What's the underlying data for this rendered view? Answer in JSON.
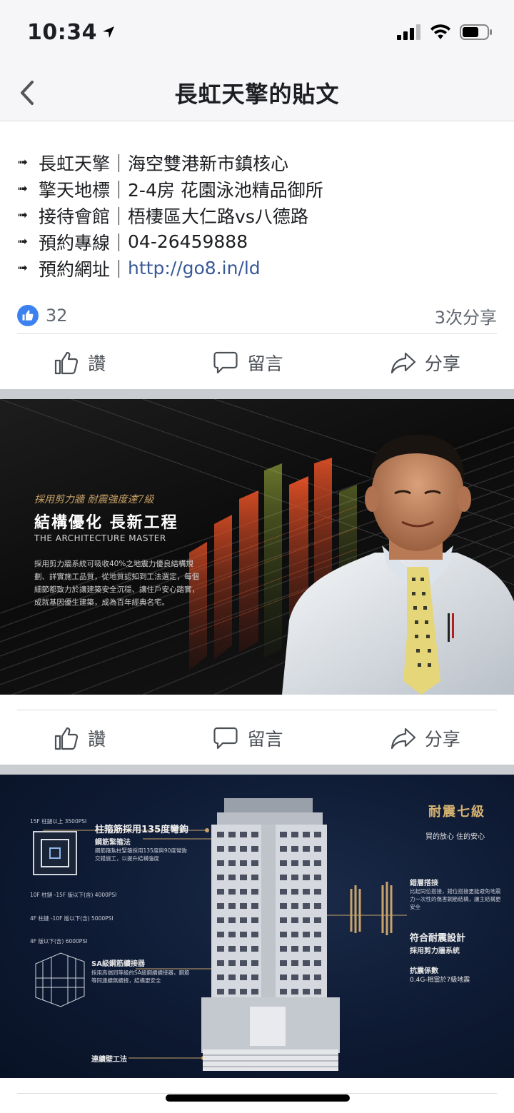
{
  "status": {
    "time": "10:34"
  },
  "nav": {
    "title": "長虹天擎的貼文"
  },
  "post": {
    "lines": [
      {
        "label": "長虹天擎",
        "text": "海空雙港新市鎮核心"
      },
      {
        "label": "擎天地標",
        "text": "2-4房 花園泳池精品御所"
      },
      {
        "label": "接待會館",
        "text": "梧棲區大仁路vs八德路"
      },
      {
        "label": "預約專線",
        "text": "04-26459888"
      },
      {
        "label": "預約網址",
        "text": "http://go8.in/ld"
      }
    ],
    "separator": "｜",
    "likes": "32",
    "shares": "3次分享"
  },
  "actions": {
    "like": "讚",
    "comment": "留言",
    "share": "分享"
  },
  "photo1": {
    "subtitle": "採用剪力牆 耐震強度達7級",
    "title": "結構優化 長新工程",
    "english": "THE ARCHITECTURE MASTER",
    "body": "採用剪力牆系統可吸收40%之地震力優良結構規劃、詳實施工品質，從地質認知到工法選定，每個細節都致力於讓建築安全沉穩、讓住戶安心踏實，成就基因優生建築，成為百年經典名宅。"
  },
  "photo2": {
    "left_labels": [
      "15F 柱鏈以上 3500PSI",
      "10F 柱鏈 -15F 版以下(含) 4000PSI",
      "4F 柱鏈 -10F 版以下(含) 5000PSI",
      "4F 版以下(含) 6000PSI"
    ],
    "hook_title": "柱箍筋採用135度彎鉤",
    "hook_sub": "鋼筋緊箍法",
    "hook_desc": "鋼筋箍紮柱緊箍採用135度與90度彎鉤交錯施工，以提升結構強度",
    "sa_title": "SA級鋼筋續接器",
    "sa_desc": "採用高端同等級的SA級鋼續續接器，鋼筋等同連續無續接，結構更安全",
    "wall": "連續壁工法",
    "seismic_title": "耐震七級",
    "seismic_sub": "買的放心 住的安心",
    "stagger_title": "錯層搭接",
    "stagger_desc": "比起同位搭接，錯位搭接更能避免地震力一次性的傷害鋼筋結構，讓主結構更安全",
    "design_title": "符合耐震設計",
    "design_sub": "採用剪力牆系統",
    "coef_title": "抗震係數",
    "coef_value": "0.4G-相當於7級地震"
  }
}
